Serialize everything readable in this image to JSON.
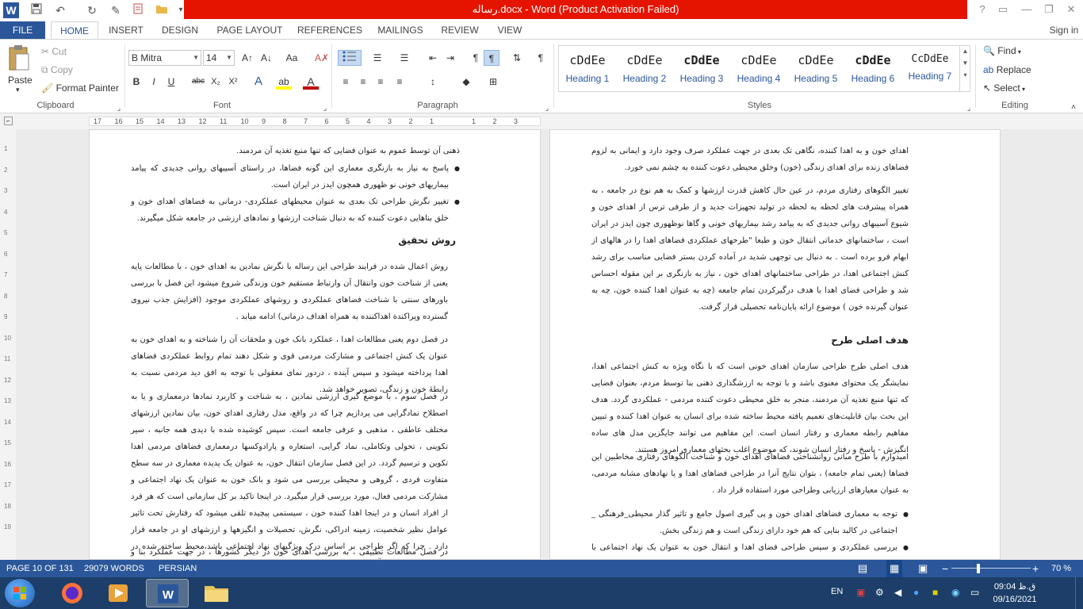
{
  "title_bar": {
    "title": "رساله.docx - Word (Product Activation Failed)",
    "help": "?",
    "restore_ribbon": "▭",
    "minimize": "—",
    "maximize": "❐",
    "close": "✕"
  },
  "quick_access": [
    {
      "name": "word-app-icon",
      "glyph": "W"
    },
    {
      "name": "save-icon",
      "glyph": "💾"
    },
    {
      "name": "undo-icon",
      "glyph": "↶"
    },
    {
      "name": "redo-icon",
      "glyph": "↻"
    },
    {
      "name": "edit-icon",
      "glyph": "✎"
    },
    {
      "name": "new-doc-icon",
      "glyph": "📄"
    },
    {
      "name": "open-folder-icon",
      "glyph": "📂"
    },
    {
      "name": "customize-icon",
      "glyph": "▾"
    }
  ],
  "tabs": {
    "file": "FILE",
    "home": "HOME",
    "insert": "INSERT",
    "design": "DESIGN",
    "page_layout": "PAGE LAYOUT",
    "references": "REFERENCES",
    "mailings": "MAILINGS",
    "review": "REVIEW",
    "view": "VIEW",
    "sign_in": "Sign in"
  },
  "clipboard": {
    "paste": "Paste",
    "cut": "Cut",
    "copy": "Copy",
    "format_painter": "Format Painter",
    "label": "Clipboard"
  },
  "font": {
    "name": "B Mitra",
    "size": "14",
    "label": "Font",
    "bold": "B",
    "italic": "I",
    "underline": "U",
    "strike": "abc",
    "subscript": "X₂",
    "superscript": "X²",
    "grow": "A↑",
    "shrink": "A↓",
    "case": "Aa",
    "clear": "A✗",
    "effects": "A",
    "highlight": "ab",
    "color": "A"
  },
  "paragraph": {
    "label": "Paragraph",
    "pilcrow": "¶"
  },
  "styles": {
    "label": "Styles",
    "items": [
      {
        "preview": "cDdEe",
        "name": "Heading 1"
      },
      {
        "preview": "cDdEe",
        "name": "Heading 2"
      },
      {
        "preview": "cDdEe",
        "name": "Heading 3"
      },
      {
        "preview": "cDdEe",
        "name": "Heading 4"
      },
      {
        "preview": "cDdEe",
        "name": "Heading 5"
      },
      {
        "preview": "cDdEe",
        "name": "Heading 6"
      },
      {
        "preview": "CcDdEe",
        "name": "Heading 7"
      }
    ]
  },
  "editing": {
    "label": "Editing",
    "find": "Find",
    "replace": "Replace",
    "select": "Select"
  },
  "ruler_ticks": [
    "17",
    "16",
    "15",
    "14",
    "13",
    "12",
    "11",
    "10",
    "9",
    "8",
    "7",
    "6",
    "5",
    "4",
    "3",
    "2",
    "1",
    "",
    "1",
    "2",
    "3"
  ],
  "vruler_ticks": [
    "1",
    "2",
    "3",
    "4",
    "5",
    "6",
    "7",
    "8",
    "9",
    "10",
    "11",
    "12",
    "13",
    "14",
    "15",
    "16",
    "17",
    "18",
    "19"
  ],
  "right_page": {
    "p1": "اهدای خون و به اهدا کننده، نگاهی تک بعدی در جهت عملکرد صرف وجود دارد و ایمانی به لزوم فضاهای زنده برای اهدای زندگی (خون) وخلق محیطی دعوت کننده به چشم نمی خورد.",
    "p2": "تغییر الگوهای رفتاری مردم، در عین حال کاهش قدرت ارزشها و کمک به هم نوع در جامعه ، به همراه پیشرفت های لحظه به لحظه در تولید تجهیزات جدید و از طرفی ترس از اهدای خون و شیوع آسیبهای روانی جدیدی که به پیامد رشد بیماریهای خونی و گاها نوظهوری چون ایدز در ایران است ، ساختمانهای خدماتی انتقال خون و طبعا \"طرحهای عملکردی فضاهای اهدا را در هالهای از ابهام فرو برده است . به دنبال بی توجهی شدید در آماده کردن بستر فضایی مناسب برای رشد کنش اجتماعی اهدا، در طراحی ساختمانهای اهدای خون ، نیاز به بازنگری بر این مقوله احساس شد و طراحی فضای اهدا با هدف درگیرکردن تمام جامعه (چه به عنوان اهدا کننده خون، چه به عنوان گیرنده خون ) موضوع ارائه پایان‌نامه تحصیلی قرار گرفت.",
    "h1": "هدف اصلی طرح",
    "p3": "هدف اصلی طرح طراحی سازمان اهدای خونی است که با نگاه ویژه به کنش اجتماعی اهدا، نمایشگر یک محتوای معنوی باشد و با توجه به ارزشگذاری ذهنی بنا توسط مردم، بعنوان فضایی که تنها منبع تغذیه آن مردمند، منجر به خلق محیطی دعوت کننده مردمی - عملکردی گردد. هدف این بحث بیان قابلیت‌های تعمیم یافته محیط ساخته شده برای انسان به عنوان اهدا کننده و تبیین مفاهیم رابطه معماری و رفتار انسان است. این مفاهیم می توانند جایگزین مدل های ساده انگیزش - پاسخ و رفتار انسان شوند، که موضوع اغلب بحثهای معماری امروز هستند.",
    "p4": "امیدوارم با طرح مبانی روانشناختی فضاهای اهدای خون و شناخت الگوهای رفتاری مخاطبین این فضاها (یعنی تمام جامعه) ، بتوان نتایج آنرا در طراحی فضاهای اهدا و یا نهادهای مشابه مردمی، به عنوان معیارهای ارزیابی وطراحی مورد استفاده قرار داد .",
    "b1": "توجه به معماری فضاهای اهدای خون و پی گیری اصول جامع و تاثیر گذار محیطی_فرهنگی _ اجتماعی در کالبد بنایی که هم خود دارای زندگی است و هم زندگی بخش.",
    "b2": "بررسی عملکردی و سپس طراحی فضای اهدا و انتقال خون به عنوان یک نهاد اجتماعی با مشارکت مردمی"
  },
  "left_page": {
    "l0": "ذهنی آن توسط عموم به عنوان فضایی که تنها منبع تغذیه آن مردمند.",
    "b1": "پاسخ به نیاز به بازنگری معماری این گونه فضاها، در راستای آسیبهای روانی جدیدی که پیامد بیماریهای خونی نو ظهوری همچون ایدز در ایران است.",
    "b2": "تغییر نگرش طراحی تک بعدی به عنوان محیطهای عملکردی- درمانی به فضاهای اهدای خون و خلق بناهایی دعوت کننده که به دنبال شناخت ارزشها و نمادهای ارزشی در جامعه شکل میگیرند.",
    "h1": "روش تحقیق",
    "p1": "روش اعمال شده در فرایند طراحی این رساله با نگرش نمادین به اهدای خون ، با مطالعات پایه یعنی از شناخت خون وانتقال آن وارتباط مستقیم خون وزندگی شروع میشود این فصل با بررسی باورهای سنتی با شناخت فضاهای عملکردی و روشهای عملکردی موجود (افزایش جذب نیروی گسترده وپراکندة اهداکننده به همراه اهداف درمانی) ادامه میابد .",
    "p2": "در فصل دوم یعنی مطالعات اهدا ، عملکرد بانک خون و ملحقات آن را شناخته و به اهدای خون به عنوان یک کنش اجتماعی و مشارکت مردمی قوی و شکل دهند تمام روابط عملکردی فضاهای اهدا پرداخته میشود و سپس آینده ، دردور نمای معقولی با توجه به افق دید مردمی نسبت به رابطهٔ خون و زندگی، تصویر خواهد شد.",
    "p3": "در فصل سوم ، با موضع گیری ارزشی نمادین ، به شناخت و کاربرد نمادها درمعماری و یا به اصطلاح نمادگرایی می پردازیم چرا که در واقع، مدل رفتاری اهدای خون، بیان نمادین ارزشهای مختلف عاطفی ، مذهبی و عرفی جامعه است. سپس کوشیده شده با دیدی همه جانبه ، سیر تکوینی ، تحولی وتکاملی، نماد گرایی، استعاره و پارادوکسها درمعماری فضاهای مردمی اهدا تکوین و ترسیم گردد. در این فصل سازمان انتقال خون، به عنوان یک پدیده معماری در سه سطح متفاوت فردی ، گروهی و محیطی بررسی می شود و بانک خون به عنوان یک نهاد اجتماعی و مشارکت مردمی فعال، مورد بررسی قرار میگیرد. در اینجا تاکید بر کل سازمانی است که هر فرد از افراد انسان و در اینجا اهدا کننده خون ، سیستمی پیچیده تلقی میشود که رفتارش تحت تاثیر عوامل نظیر شخصیت، زمینه ادراکی، نگرش، تحصیلات و انگیزهها و ارزشهای او در جامعه قرار دارد . چرا که اگر طراحی بر اساس درک ویژگیهای نهاد اجتماعی باشد،محیط ساخته شده در جهت تسهیل کارکرد آن نهاد عمل می کند.",
    "p4": "در فصل مطالعات تطبیقی ، به بررسی اهدای خون در دیگر کشورها ، در جهت عملکرد بنا و شناخت مخاطبین"
  },
  "status": {
    "page": "PAGE 10 OF 131",
    "words": "29079 WORDS",
    "language": "PERSIAN",
    "zoom": "70 %",
    "zoom_level": 70
  },
  "taskbar": {
    "lang": "EN",
    "time": "09:04 ق.ظ",
    "date": "09/16/2021"
  }
}
